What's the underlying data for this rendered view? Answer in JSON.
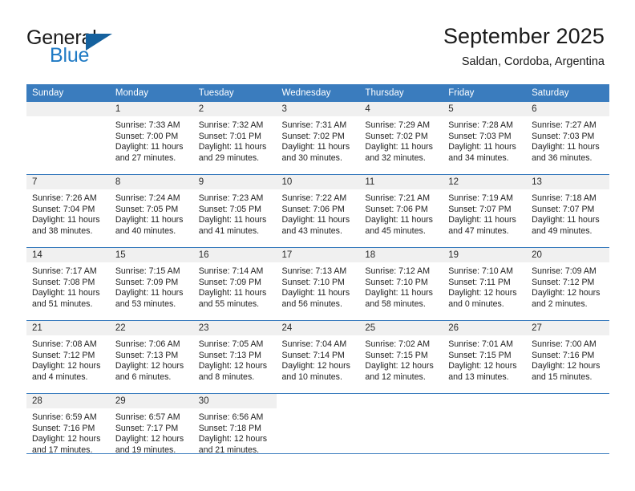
{
  "brand": {
    "name_top": "General",
    "name_bottom": "Blue",
    "accent_color": "#1f7ac4",
    "triangle_color": "#15619e"
  },
  "header": {
    "title": "September 2025",
    "subtitle": "Saldan, Cordoba, Argentina"
  },
  "colors": {
    "header_row_bg": "#3a7cbe",
    "header_row_text": "#ffffff",
    "daynum_band_bg": "#f0f0f0",
    "body_text": "#222222",
    "rule": "#3a7cbe"
  },
  "weekdays": [
    "Sunday",
    "Monday",
    "Tuesday",
    "Wednesday",
    "Thursday",
    "Friday",
    "Saturday"
  ],
  "weeks": [
    [
      {
        "day": "",
        "sunrise": "",
        "sunset": "",
        "daylight_line1": "",
        "daylight_line2": "",
        "empty": true
      },
      {
        "day": "1",
        "sunrise": "Sunrise: 7:33 AM",
        "sunset": "Sunset: 7:00 PM",
        "daylight_line1": "Daylight: 11 hours",
        "daylight_line2": "and 27 minutes."
      },
      {
        "day": "2",
        "sunrise": "Sunrise: 7:32 AM",
        "sunset": "Sunset: 7:01 PM",
        "daylight_line1": "Daylight: 11 hours",
        "daylight_line2": "and 29 minutes."
      },
      {
        "day": "3",
        "sunrise": "Sunrise: 7:31 AM",
        "sunset": "Sunset: 7:02 PM",
        "daylight_line1": "Daylight: 11 hours",
        "daylight_line2": "and 30 minutes."
      },
      {
        "day": "4",
        "sunrise": "Sunrise: 7:29 AM",
        "sunset": "Sunset: 7:02 PM",
        "daylight_line1": "Daylight: 11 hours",
        "daylight_line2": "and 32 minutes."
      },
      {
        "day": "5",
        "sunrise": "Sunrise: 7:28 AM",
        "sunset": "Sunset: 7:03 PM",
        "daylight_line1": "Daylight: 11 hours",
        "daylight_line2": "and 34 minutes."
      },
      {
        "day": "6",
        "sunrise": "Sunrise: 7:27 AM",
        "sunset": "Sunset: 7:03 PM",
        "daylight_line1": "Daylight: 11 hours",
        "daylight_line2": "and 36 minutes."
      }
    ],
    [
      {
        "day": "7",
        "sunrise": "Sunrise: 7:26 AM",
        "sunset": "Sunset: 7:04 PM",
        "daylight_line1": "Daylight: 11 hours",
        "daylight_line2": "and 38 minutes."
      },
      {
        "day": "8",
        "sunrise": "Sunrise: 7:24 AM",
        "sunset": "Sunset: 7:05 PM",
        "daylight_line1": "Daylight: 11 hours",
        "daylight_line2": "and 40 minutes."
      },
      {
        "day": "9",
        "sunrise": "Sunrise: 7:23 AM",
        "sunset": "Sunset: 7:05 PM",
        "daylight_line1": "Daylight: 11 hours",
        "daylight_line2": "and 41 minutes."
      },
      {
        "day": "10",
        "sunrise": "Sunrise: 7:22 AM",
        "sunset": "Sunset: 7:06 PM",
        "daylight_line1": "Daylight: 11 hours",
        "daylight_line2": "and 43 minutes."
      },
      {
        "day": "11",
        "sunrise": "Sunrise: 7:21 AM",
        "sunset": "Sunset: 7:06 PM",
        "daylight_line1": "Daylight: 11 hours",
        "daylight_line2": "and 45 minutes."
      },
      {
        "day": "12",
        "sunrise": "Sunrise: 7:19 AM",
        "sunset": "Sunset: 7:07 PM",
        "daylight_line1": "Daylight: 11 hours",
        "daylight_line2": "and 47 minutes."
      },
      {
        "day": "13",
        "sunrise": "Sunrise: 7:18 AM",
        "sunset": "Sunset: 7:07 PM",
        "daylight_line1": "Daylight: 11 hours",
        "daylight_line2": "and 49 minutes."
      }
    ],
    [
      {
        "day": "14",
        "sunrise": "Sunrise: 7:17 AM",
        "sunset": "Sunset: 7:08 PM",
        "daylight_line1": "Daylight: 11 hours",
        "daylight_line2": "and 51 minutes."
      },
      {
        "day": "15",
        "sunrise": "Sunrise: 7:15 AM",
        "sunset": "Sunset: 7:09 PM",
        "daylight_line1": "Daylight: 11 hours",
        "daylight_line2": "and 53 minutes."
      },
      {
        "day": "16",
        "sunrise": "Sunrise: 7:14 AM",
        "sunset": "Sunset: 7:09 PM",
        "daylight_line1": "Daylight: 11 hours",
        "daylight_line2": "and 55 minutes."
      },
      {
        "day": "17",
        "sunrise": "Sunrise: 7:13 AM",
        "sunset": "Sunset: 7:10 PM",
        "daylight_line1": "Daylight: 11 hours",
        "daylight_line2": "and 56 minutes."
      },
      {
        "day": "18",
        "sunrise": "Sunrise: 7:12 AM",
        "sunset": "Sunset: 7:10 PM",
        "daylight_line1": "Daylight: 11 hours",
        "daylight_line2": "and 58 minutes."
      },
      {
        "day": "19",
        "sunrise": "Sunrise: 7:10 AM",
        "sunset": "Sunset: 7:11 PM",
        "daylight_line1": "Daylight: 12 hours",
        "daylight_line2": "and 0 minutes."
      },
      {
        "day": "20",
        "sunrise": "Sunrise: 7:09 AM",
        "sunset": "Sunset: 7:12 PM",
        "daylight_line1": "Daylight: 12 hours",
        "daylight_line2": "and 2 minutes."
      }
    ],
    [
      {
        "day": "21",
        "sunrise": "Sunrise: 7:08 AM",
        "sunset": "Sunset: 7:12 PM",
        "daylight_line1": "Daylight: 12 hours",
        "daylight_line2": "and 4 minutes."
      },
      {
        "day": "22",
        "sunrise": "Sunrise: 7:06 AM",
        "sunset": "Sunset: 7:13 PM",
        "daylight_line1": "Daylight: 12 hours",
        "daylight_line2": "and 6 minutes."
      },
      {
        "day": "23",
        "sunrise": "Sunrise: 7:05 AM",
        "sunset": "Sunset: 7:13 PM",
        "daylight_line1": "Daylight: 12 hours",
        "daylight_line2": "and 8 minutes."
      },
      {
        "day": "24",
        "sunrise": "Sunrise: 7:04 AM",
        "sunset": "Sunset: 7:14 PM",
        "daylight_line1": "Daylight: 12 hours",
        "daylight_line2": "and 10 minutes."
      },
      {
        "day": "25",
        "sunrise": "Sunrise: 7:02 AM",
        "sunset": "Sunset: 7:15 PM",
        "daylight_line1": "Daylight: 12 hours",
        "daylight_line2": "and 12 minutes."
      },
      {
        "day": "26",
        "sunrise": "Sunrise: 7:01 AM",
        "sunset": "Sunset: 7:15 PM",
        "daylight_line1": "Daylight: 12 hours",
        "daylight_line2": "and 13 minutes."
      },
      {
        "day": "27",
        "sunrise": "Sunrise: 7:00 AM",
        "sunset": "Sunset: 7:16 PM",
        "daylight_line1": "Daylight: 12 hours",
        "daylight_line2": "and 15 minutes."
      }
    ],
    [
      {
        "day": "28",
        "sunrise": "Sunrise: 6:59 AM",
        "sunset": "Sunset: 7:16 PM",
        "daylight_line1": "Daylight: 12 hours",
        "daylight_line2": "and 17 minutes."
      },
      {
        "day": "29",
        "sunrise": "Sunrise: 6:57 AM",
        "sunset": "Sunset: 7:17 PM",
        "daylight_line1": "Daylight: 12 hours",
        "daylight_line2": "and 19 minutes."
      },
      {
        "day": "30",
        "sunrise": "Sunrise: 6:56 AM",
        "sunset": "Sunset: 7:18 PM",
        "daylight_line1": "Daylight: 12 hours",
        "daylight_line2": "and 21 minutes."
      },
      {
        "day": "",
        "sunrise": "",
        "sunset": "",
        "daylight_line1": "",
        "daylight_line2": "",
        "empty": true,
        "blank": true
      },
      {
        "day": "",
        "sunrise": "",
        "sunset": "",
        "daylight_line1": "",
        "daylight_line2": "",
        "empty": true,
        "blank": true
      },
      {
        "day": "",
        "sunrise": "",
        "sunset": "",
        "daylight_line1": "",
        "daylight_line2": "",
        "empty": true,
        "blank": true
      },
      {
        "day": "",
        "sunrise": "",
        "sunset": "",
        "daylight_line1": "",
        "daylight_line2": "",
        "empty": true,
        "blank": true
      }
    ]
  ]
}
